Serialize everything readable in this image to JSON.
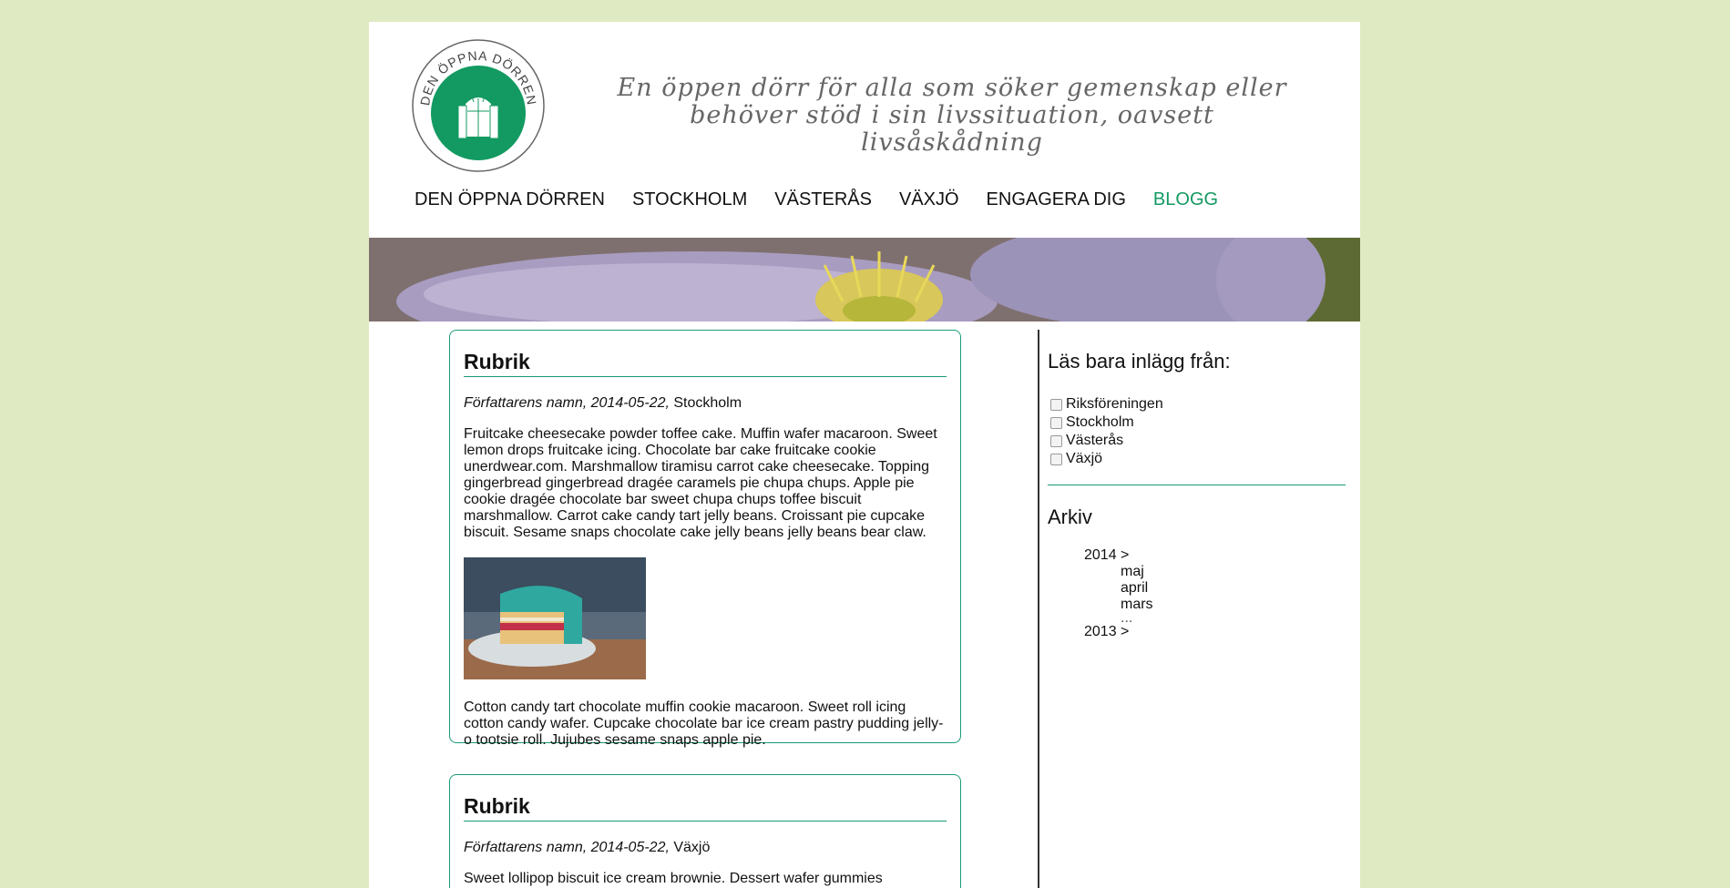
{
  "header": {
    "logo_text": "DEN ÖPPNA DÖRREN",
    "tagline_line1": "En öppen dörr för alla som söker gemenskap eller",
    "tagline_line2": "behöver stöd i sin livssituation, oavsett livsåskådning"
  },
  "nav": {
    "items": [
      {
        "label": "DEN ÖPPNA DÖRREN"
      },
      {
        "label": "STOCKHOLM"
      },
      {
        "label": "VÄSTERÅS"
      },
      {
        "label": "VÄXJÖ"
      },
      {
        "label": "ENGAGERA DIG"
      },
      {
        "label": "BLOGG"
      }
    ]
  },
  "colors": {
    "accent": "#139a62",
    "page_bg": "#dfeac3",
    "border": "#1a9a78"
  },
  "posts": [
    {
      "title": "Rubrik",
      "author_date": "Författarens namn, 2014-05-22,",
      "location": "Stockholm",
      "para1": "Fruitcake cheesecake powder toffee cake. Muffin wafer macaroon. Sweet lemon drops fruitcake icing. Chocolate bar cake fruitcake cookie unerdwear.com. Marshmallow tiramisu carrot cake cheesecake. Topping gingerbread gingerbread dragée caramels pie chupa chups. Apple pie cookie dragée chocolate bar sweet chupa chups toffee biscuit marshmallow. Carrot cake candy tart jelly beans. Croissant pie cupcake biscuit. Sesame snaps chocolate cake jelly beans jelly beans bear claw.",
      "para2": "Cotton candy tart chocolate muffin cookie macaroon. Sweet roll icing cotton candy wafer. Cupcake chocolate bar ice cream pastry pudding jelly-o tootsie roll. Jujubes sesame snaps apple pie."
    },
    {
      "title": "Rubrik",
      "author_date": "Författarens namn, 2014-05-22,",
      "location": "Växjö",
      "para1": "Sweet lollipop biscuit ice cream brownie. Dessert wafer gummies"
    }
  ],
  "sidebar": {
    "filter_title": "Läs bara inlägg från:",
    "filters": [
      {
        "label": "Riksföreningen"
      },
      {
        "label": "Stockholm"
      },
      {
        "label": "Västerås"
      },
      {
        "label": "Växjö"
      }
    ],
    "archive_title": "Arkiv",
    "archive": {
      "year1": "2014 >",
      "months": [
        "maj",
        "april",
        "mars",
        "..."
      ],
      "year2": "2013 >"
    }
  }
}
